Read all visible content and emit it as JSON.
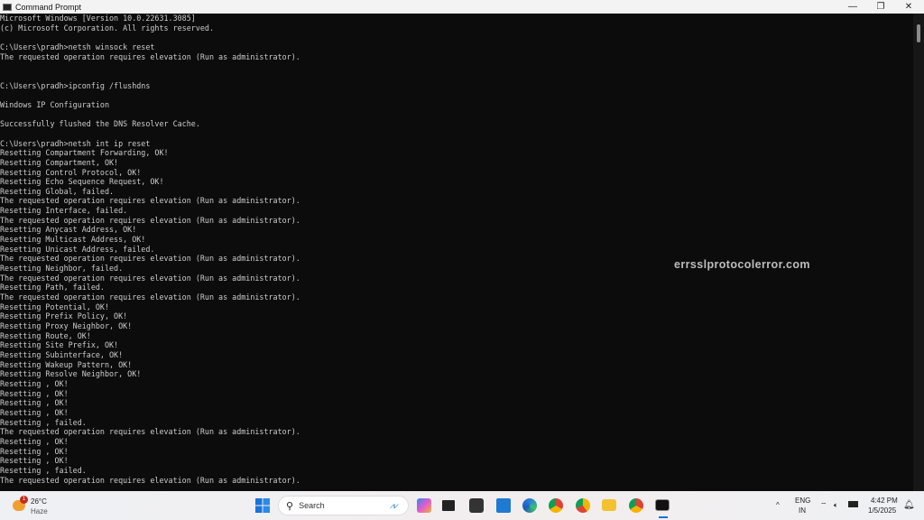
{
  "window": {
    "title": "Command Prompt",
    "minimize": "—",
    "maximize": "❐",
    "close": "✕"
  },
  "console": {
    "lines": [
      "Microsoft Windows [Version 10.0.22631.3085]",
      "(c) Microsoft Corporation. All rights reserved.",
      "",
      "C:\\Users\\pradh>netsh winsock reset",
      "The requested operation requires elevation (Run as administrator).",
      "",
      "",
      "C:\\Users\\pradh>ipconfig /flushdns",
      "",
      "Windows IP Configuration",
      "",
      "Successfully flushed the DNS Resolver Cache.",
      "",
      "C:\\Users\\pradh>netsh int ip reset",
      "Resetting Compartment Forwarding, OK!",
      "Resetting Compartment, OK!",
      "Resetting Control Protocol, OK!",
      "Resetting Echo Sequence Request, OK!",
      "Resetting Global, failed.",
      "The requested operation requires elevation (Run as administrator).",
      "Resetting Interface, failed.",
      "The requested operation requires elevation (Run as administrator).",
      "Resetting Anycast Address, OK!",
      "Resetting Multicast Address, OK!",
      "Resetting Unicast Address, failed.",
      "The requested operation requires elevation (Run as administrator).",
      "Resetting Neighbor, failed.",
      "The requested operation requires elevation (Run as administrator).",
      "Resetting Path, failed.",
      "The requested operation requires elevation (Run as administrator).",
      "Resetting Potential, OK!",
      "Resetting Prefix Policy, OK!",
      "Resetting Proxy Neighbor, OK!",
      "Resetting Route, OK!",
      "Resetting Site Prefix, OK!",
      "Resetting Subinterface, OK!",
      "Resetting Wakeup Pattern, OK!",
      "Resetting Resolve Neighbor, OK!",
      "Resetting , OK!",
      "Resetting , OK!",
      "Resetting , OK!",
      "Resetting , OK!",
      "Resetting , failed.",
      "The requested operation requires elevation (Run as administrator).",
      "Resetting , OK!",
      "Resetting , OK!",
      "Resetting , OK!",
      "Resetting , failed.",
      "The requested operation requires elevation (Run as administrator)."
    ]
  },
  "watermark": "errsslprotocolerror.com",
  "taskbar": {
    "weather": {
      "temp": "26°C",
      "condition": "Haze",
      "badge": "1"
    },
    "search_label": "Search",
    "apps": [
      "copilot",
      "task-view",
      "obs",
      "vscode",
      "edge",
      "chrome",
      "chrome-canary",
      "file-explorer",
      "chrome-profile",
      "command-prompt"
    ],
    "tray": {
      "lang": "ENG",
      "region": "IN",
      "time": "4:42 PM",
      "date": "1/5/2025"
    }
  }
}
